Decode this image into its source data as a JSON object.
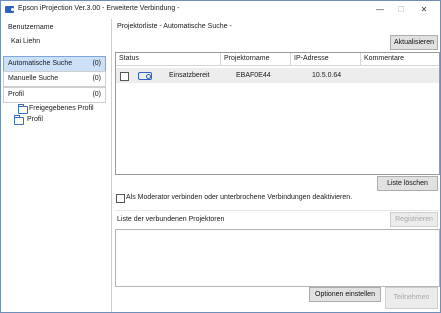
{
  "window": {
    "title": "Epson iProjection Ver.3.00 - Erweiterte Verbindung -",
    "minimize": "—",
    "maximize": "☐",
    "close": "✕"
  },
  "sidebar": {
    "user_heading": "Benutzername",
    "user_name": "Kai Liehn",
    "items": [
      {
        "label": "Automatische Suche",
        "count": "(0)"
      },
      {
        "label": "Manuelle Suche",
        "count": "(0)"
      },
      {
        "label": "Profil",
        "count": "(0)"
      }
    ],
    "tree": [
      "Freigegebenes Profil",
      "Profil"
    ]
  },
  "main": {
    "list_heading": "Projektorliste - Automatische Suche -",
    "refresh_label": "Aktualisieren",
    "columns": [
      "Status",
      "Projektorname",
      "IP-Adresse",
      "Kommentare"
    ],
    "rows": [
      {
        "status": "Einsatzbereit",
        "name": "EBAF0E44",
        "ip": "10.5.0.64",
        "comment": ""
      }
    ],
    "clear_list_label": "Liste löschen",
    "moderator_label": "Als Moderator verbinden oder unterbrochene Verbindungen deaktivieren.",
    "register_label": "Registrieren",
    "connected_heading": "Liste der verbundenen Projektoren",
    "options_label": "Optionen einstellen",
    "join_label": "Teilnehmen"
  }
}
